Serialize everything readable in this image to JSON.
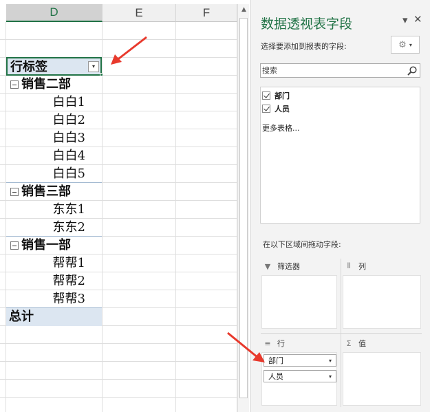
{
  "sheet": {
    "columns": [
      "D",
      "E",
      "F"
    ],
    "pivot": {
      "header_label": "行标签",
      "filter_glyph": "▾",
      "groups": [
        {
          "name": "销售二部",
          "items": [
            "白白1",
            "白白2",
            "白白3",
            "白白4",
            "白白5"
          ]
        },
        {
          "name": "销售三部",
          "items": [
            "东东1",
            "东东2"
          ]
        },
        {
          "name": "销售一部",
          "items": [
            "帮帮1",
            "帮帮2",
            "帮帮3"
          ]
        }
      ],
      "total_label": "总计"
    },
    "scroll_up_glyph": "▲"
  },
  "pane": {
    "title": "数据透视表字段",
    "menu_glyph": "▾",
    "close_glyph": "✕",
    "choose_fields_label": "选择要添加到报表的字段:",
    "gear_glyph": "⚙",
    "gear_caret": "▾",
    "search_placeholder": "搜索",
    "fields": [
      {
        "label": "部门",
        "checked": true
      },
      {
        "label": "人员",
        "checked": true
      }
    ],
    "more_tables": "更多表格...",
    "drag_label": "在以下区域间拖动字段:",
    "areas": {
      "filters": {
        "label": "筛选器",
        "icon": "filter-icon",
        "glyph": "▼"
      },
      "columns": {
        "label": "列",
        "icon": "columns-icon",
        "glyph": "⦀"
      },
      "rows": {
        "label": "行",
        "icon": "rows-icon",
        "glyph": "≡",
        "chips": [
          "部门",
          "人员"
        ]
      },
      "values": {
        "label": "值",
        "icon": "sigma-icon",
        "glyph": "Σ"
      }
    },
    "chip_caret": "▾"
  },
  "colors": {
    "accent_green": "#217346",
    "pivot_header_fill": "#dce6f1",
    "annotation_red": "#e8392c"
  }
}
